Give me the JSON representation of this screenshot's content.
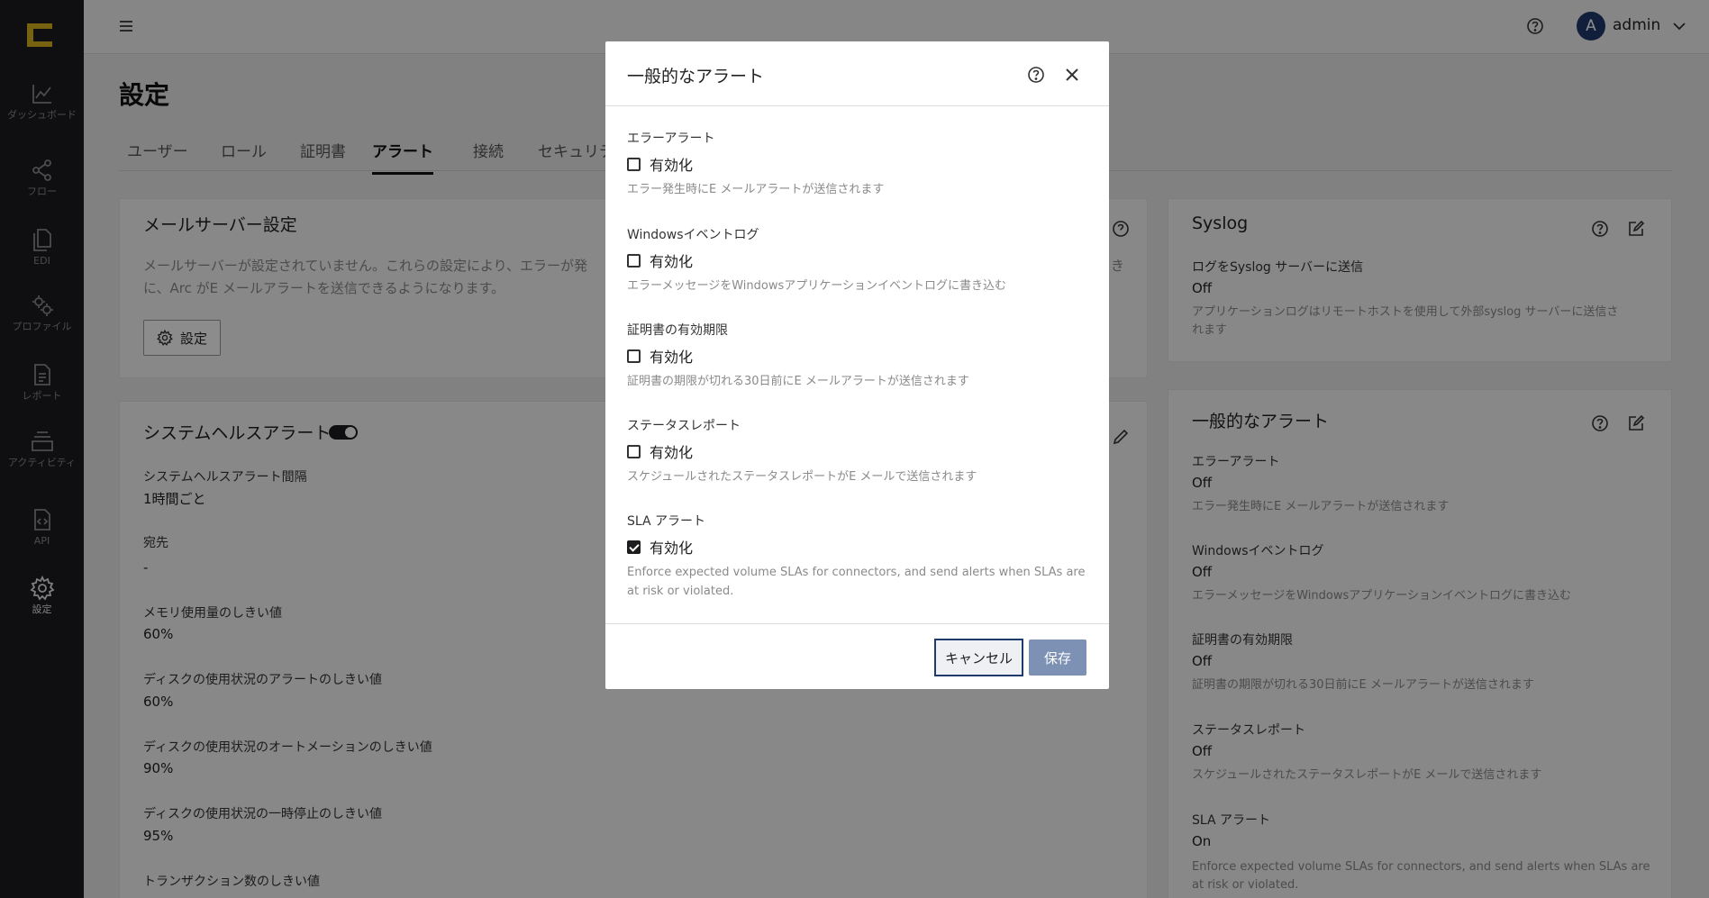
{
  "sidebar": {
    "items": [
      {
        "label": "ダッシュボード",
        "icon": "chart-icon"
      },
      {
        "label": "フロー",
        "icon": "share-icon"
      },
      {
        "label": "EDI",
        "icon": "files-icon"
      },
      {
        "label": "プロファイル",
        "icon": "gears-icon"
      },
      {
        "label": "レポート",
        "icon": "document-icon"
      },
      {
        "label": "アクティビティ",
        "icon": "layers-icon"
      },
      {
        "label": "API",
        "icon": "code-file-icon"
      },
      {
        "label": "設定",
        "icon": "gear-icon"
      }
    ]
  },
  "topbar": {
    "avatar_letter": "A",
    "username": "admin"
  },
  "page": {
    "title": "設定",
    "tabs": [
      "ユーザー",
      "ロール",
      "証明書",
      "アラート",
      "接続",
      "セキュリテ"
    ],
    "active_tab": "アラート"
  },
  "mail_card": {
    "title": "メールサーバー設定",
    "desc_line1": "メールサーバーが設定されていません。これらの設定により、エラーが発",
    "desc_line2": "に、Arc がE メールアラートを送信できるようになります。",
    "trailing_fragment": "き",
    "settings_button": "設定"
  },
  "health_card": {
    "title": "システムヘルスアラート",
    "fields": [
      {
        "label": "システムヘルスアラート間隔",
        "value": "1時間ごと"
      },
      {
        "label": "宛先",
        "value": "-"
      },
      {
        "label": "メモリ使用量のしきい値",
        "value": "60%"
      },
      {
        "label": "ディスクの使用状況のアラートのしきい値",
        "value": "60%"
      },
      {
        "label": "ディスクの使用状況のオートメーションのしきい値",
        "value": "90%"
      },
      {
        "label": "ディスクの使用状況の一時停止のしきい値",
        "value": "95%"
      },
      {
        "label": "トランザクション数のしきい値",
        "value": ""
      }
    ]
  },
  "syslog_card": {
    "title": "Syslog",
    "label": "ログをSyslog サーバーに送信",
    "value": "Off",
    "desc_line1": "アプリケーションログはリモートホストを使用して外部syslog サーバーに送信さ",
    "desc_line2": "れます"
  },
  "general_card": {
    "title": "一般的なアラート",
    "items": [
      {
        "label": "エラーアラート",
        "value": "Off",
        "desc": "エラー発生時にE メールアラートが送信されます"
      },
      {
        "label": "Windowsイベントログ",
        "value": "Off",
        "desc": "エラーメッセージをWindowsアプリケーションイベントログに書き込む"
      },
      {
        "label": "証明書の有効期限",
        "value": "Off",
        "desc": "証明書の期限が切れる30日前にE メールアラートが送信されます"
      },
      {
        "label": "ステータスレポート",
        "value": "Off",
        "desc": "スケジュールされたステータスレポートがE メールで送信されます"
      },
      {
        "label": "SLA アラート",
        "value": "On",
        "desc_line1": "Enforce expected volume SLAs for connectors, and send alerts when SLAs are",
        "desc_line2": "at risk or violated."
      }
    ]
  },
  "modal": {
    "title": "一般的なアラート",
    "checkbox_label": "有効化",
    "sections": [
      {
        "title": "エラーアラート",
        "checked": false,
        "desc": "エラー発生時にE メールアラートが送信されます"
      },
      {
        "title": "Windowsイベントログ",
        "checked": false,
        "desc": "エラーメッセージをWindowsアプリケーションイベントログに書き込む"
      },
      {
        "title": "証明書の有効期限",
        "checked": false,
        "desc": "証明書の期限が切れる30日前にE メールアラートが送信されます"
      },
      {
        "title": "ステータスレポート",
        "checked": false,
        "desc": "スケジュールされたステータスレポートがE メールで送信されます"
      },
      {
        "title": "SLA アラート",
        "checked": true,
        "desc_line1": "Enforce expected volume SLAs for connectors, and send alerts when SLAs are",
        "desc_line2": "at risk or violated."
      }
    ],
    "cancel_label": "キャンセル",
    "save_label": "保存"
  },
  "colors": {
    "sidebar_bg": "#1d1d1f",
    "logo_accent": "#d8b31c",
    "avatar_bg": "#1f3a6d",
    "save_bg": "#7d91b4"
  }
}
